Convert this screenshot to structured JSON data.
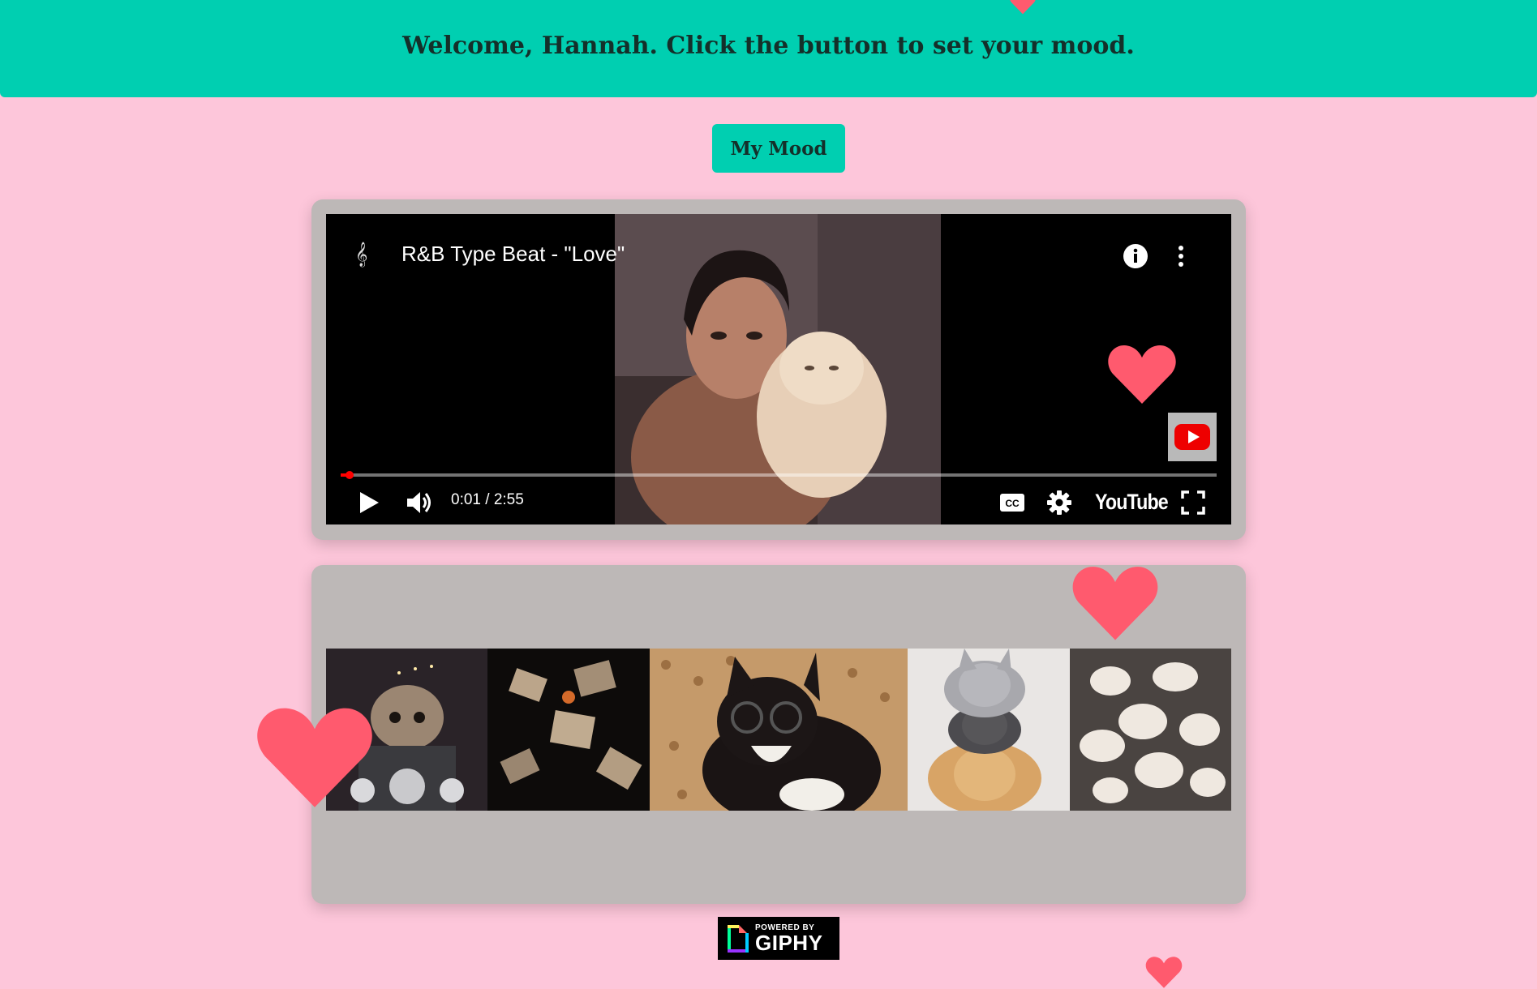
{
  "header": {
    "welcome_text": "Welcome, Hannah. Click the button to set your mood."
  },
  "mood_button": {
    "label": "My Mood"
  },
  "video": {
    "title": "R&B Type Beat - \"Love\"",
    "time": "0:01 / 2:55",
    "progress": 0.008,
    "brand": "YouTube"
  },
  "giphy": {
    "powered_by": "POWERED BY",
    "brand": "GIPHY"
  },
  "gifs": [
    "cat-on-motorcycle",
    "cats-flying-debris",
    "cat-with-glasses",
    "stacked-cats",
    "white-kittens"
  ],
  "colors": {
    "background": "#fdc6da",
    "accent": "#00cfb1",
    "card": "#bdb8b7",
    "heart": "#ff5a6e"
  }
}
